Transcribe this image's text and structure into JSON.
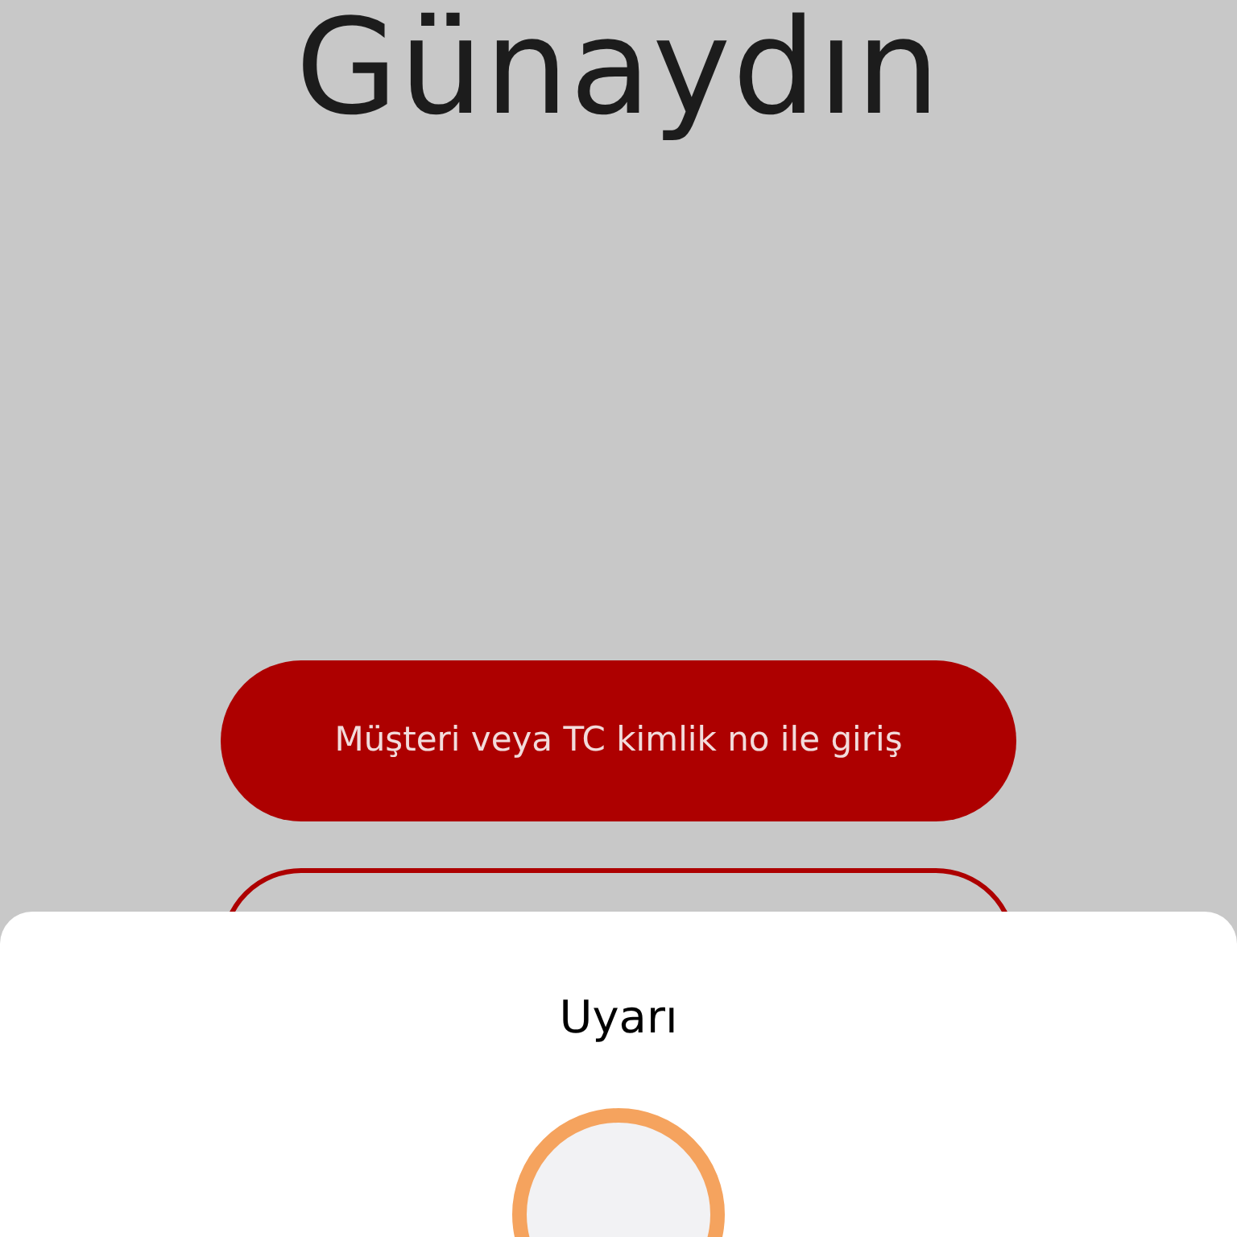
{
  "greeting": "Günaydın",
  "buttons": [
    {
      "kind": "filled",
      "label": "Müşteri veya TC kimlik no ile giriş"
    },
    {
      "kind": "outline"
    }
  ],
  "sheet": {
    "title": "Uyarı"
  }
}
